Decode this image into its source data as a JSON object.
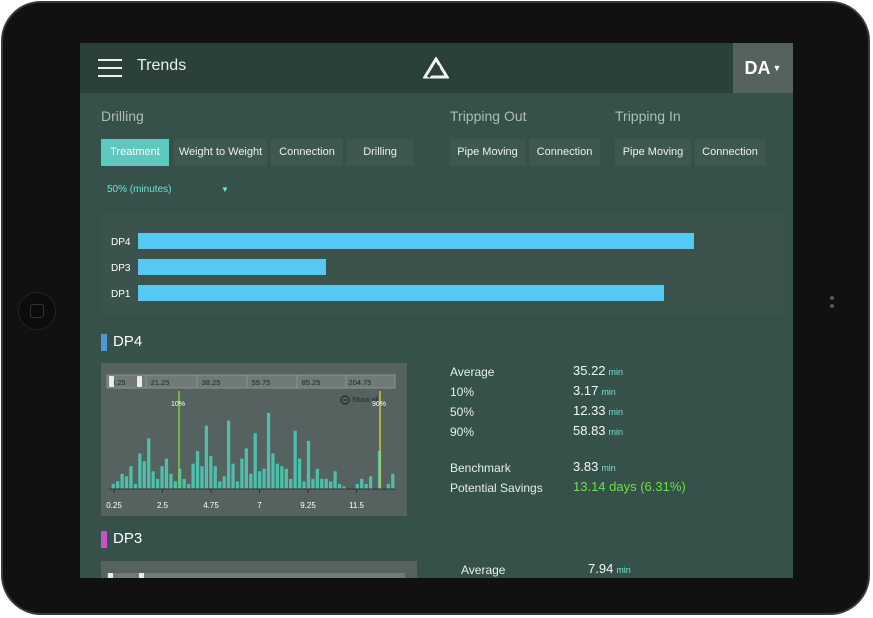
{
  "header": {
    "title": "Trends",
    "user": "DA"
  },
  "sections": {
    "drilling": "Drilling",
    "tripping_out": "Tripping Out",
    "tripping_in": "Tripping In"
  },
  "tabs": {
    "drilling": [
      "Treatment",
      "Weight to Weight",
      "Connection",
      "Drilling"
    ],
    "tripping_out": [
      "Pipe Moving",
      "Connection"
    ],
    "tripping_in": [
      "Pipe Moving",
      "Connection"
    ],
    "active": "Treatment"
  },
  "selector": {
    "value": "50% (minutes)"
  },
  "bar_summary": {
    "rows": [
      {
        "label": "DP4",
        "value_fraction": 1.0
      },
      {
        "label": "DP3",
        "value_fraction": 0.338
      },
      {
        "label": "DP1",
        "value_fraction": 0.946
      }
    ],
    "color": "#55c9f2"
  },
  "dp4": {
    "name": "DP4",
    "marker_color": "#4a9ad6",
    "histogram": {
      "top_ticks": [
        "0.25",
        "21.25",
        "38.25",
        "59.75",
        "85.25",
        "204.75"
      ],
      "show_all": "Show all",
      "markers": [
        "10%",
        "90%"
      ],
      "bottom_ticks": [
        "0.25",
        "2.5",
        "4.75",
        "7",
        "9.25",
        "11.5"
      ]
    },
    "stats": {
      "average_label": "Average",
      "average_value": "35.22",
      "average_unit": "min",
      "p10_label": "10%",
      "p10_value": "3.17",
      "p10_unit": "min",
      "p50_label": "50%",
      "p50_value": "12.33",
      "p50_unit": "min",
      "p90_label": "90%",
      "p90_value": "58.83",
      "p90_unit": "min",
      "benchmark_label": "Benchmark",
      "benchmark_value": "3.83",
      "benchmark_unit": "min",
      "savings_label": "Potential Savings",
      "savings_value": "13.14 days (6.31%)"
    }
  },
  "dp3": {
    "name": "DP3",
    "marker_color": "#c256c8",
    "stats": {
      "average_label": "Average",
      "average_value": "7.94",
      "average_unit": "min"
    }
  },
  "chart_data": {
    "type": "bar",
    "title": "",
    "x_ticks": [
      0.25,
      2.5,
      4.75,
      7,
      9.25,
      11.5
    ],
    "bar_color": "#4fbfad",
    "markers": [
      {
        "label": "10%",
        "color": "#7fcf3f"
      },
      {
        "label": "90%",
        "color": "#c9c93a"
      }
    ],
    "values": [
      2,
      3,
      6,
      5,
      9,
      2,
      14,
      11,
      20,
      7,
      4,
      9,
      12,
      6,
      3,
      8,
      4,
      2,
      10,
      15,
      9,
      25,
      13,
      9,
      3,
      5,
      27,
      10,
      3,
      12,
      16,
      6,
      22,
      7,
      8,
      30,
      14,
      10,
      9,
      8,
      4,
      23,
      12,
      3,
      19,
      4,
      8,
      4,
      4,
      3,
      7,
      2,
      1,
      0,
      0,
      2,
      4,
      2,
      5,
      0,
      15,
      0,
      2,
      6
    ]
  }
}
